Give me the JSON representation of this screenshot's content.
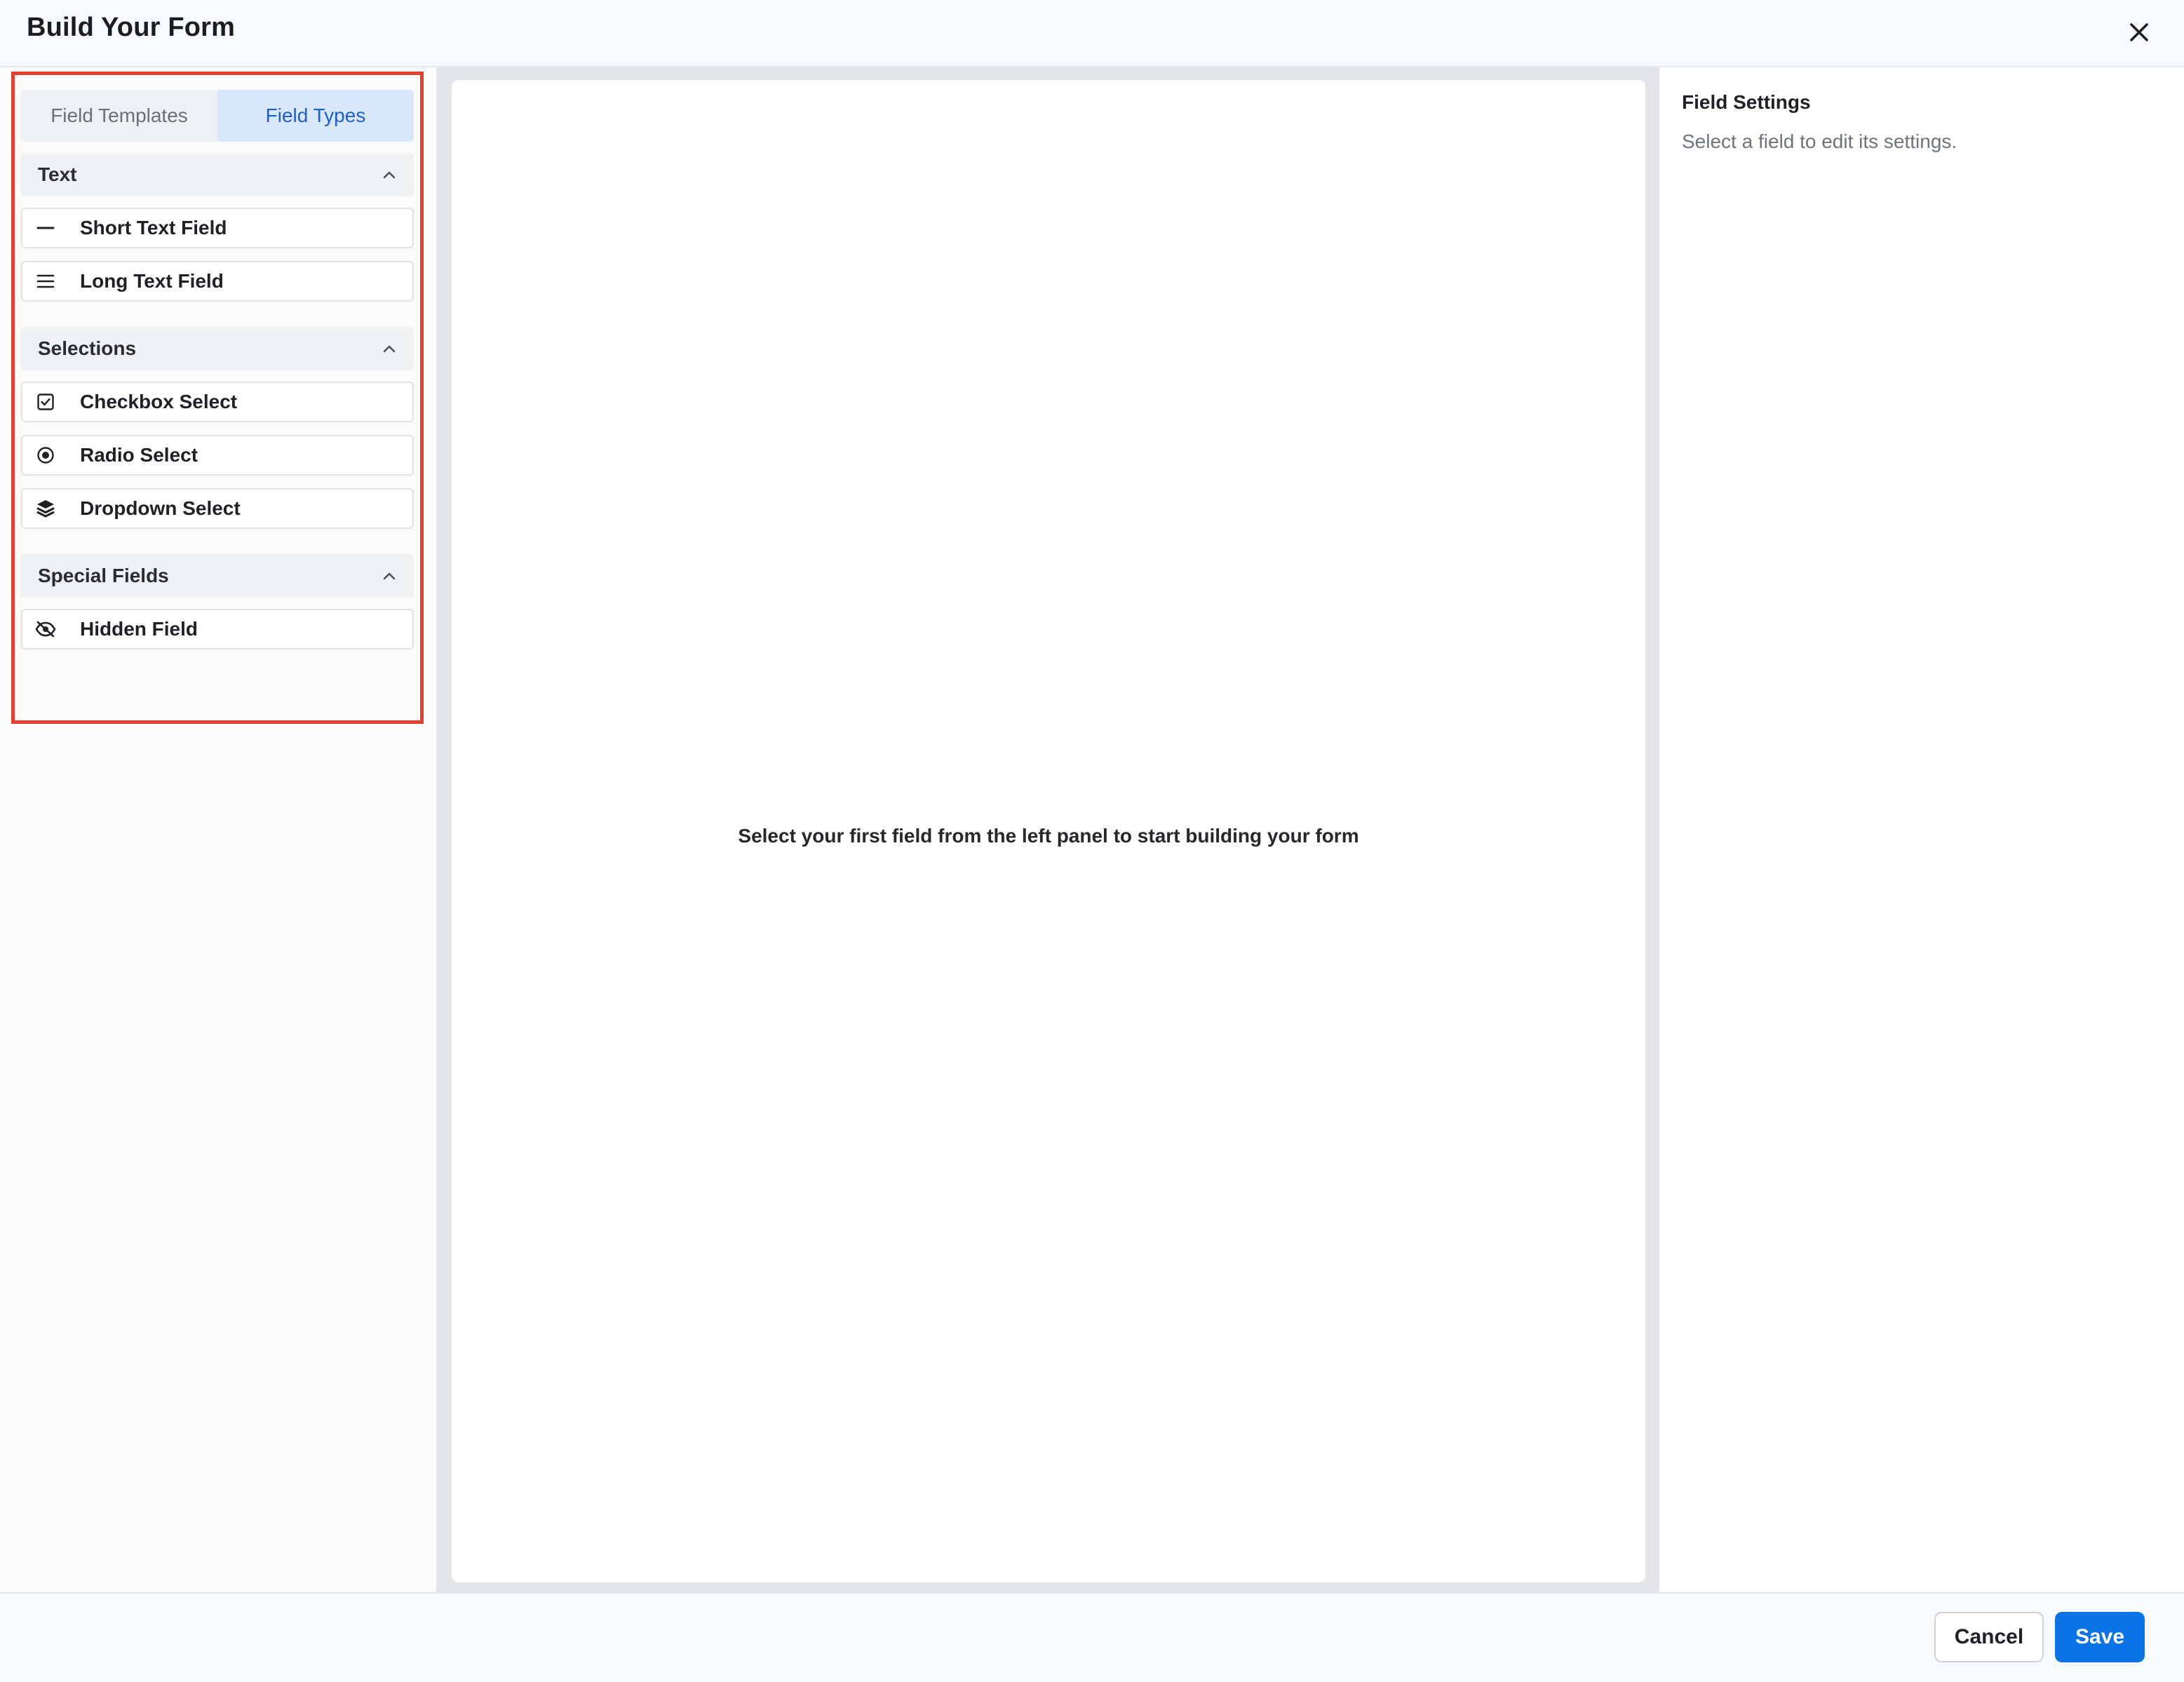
{
  "header": {
    "title": "Build Your Form",
    "close_icon": "close-icon"
  },
  "left_panel": {
    "tabs": [
      {
        "label": "Field Templates",
        "active": false
      },
      {
        "label": "Field Types",
        "active": true
      }
    ],
    "groups": [
      {
        "label": "Text",
        "expanded": true,
        "items": [
          {
            "label": "Short Text Field",
            "icon": "minus-icon"
          },
          {
            "label": "Long Text Field",
            "icon": "lines-icon"
          }
        ]
      },
      {
        "label": "Selections",
        "expanded": true,
        "items": [
          {
            "label": "Checkbox Select",
            "icon": "checkbox-icon"
          },
          {
            "label": "Radio Select",
            "icon": "radio-icon"
          },
          {
            "label": "Dropdown Select",
            "icon": "layers-icon"
          }
        ]
      },
      {
        "label": "Special Fields",
        "expanded": true,
        "items": [
          {
            "label": "Hidden Field",
            "icon": "eye-off-icon"
          }
        ]
      }
    ]
  },
  "canvas": {
    "empty_message": "Select your first field from the left panel to start building your form"
  },
  "settings": {
    "title": "Field Settings",
    "hint": "Select a field to edit its settings."
  },
  "footer": {
    "cancel_label": "Cancel",
    "save_label": "Save"
  },
  "colors": {
    "accent": "#0a74e6",
    "active_tab_bg": "#d9e7fb",
    "active_tab_text": "#1b5fd1",
    "highlight": "#e3402f"
  }
}
